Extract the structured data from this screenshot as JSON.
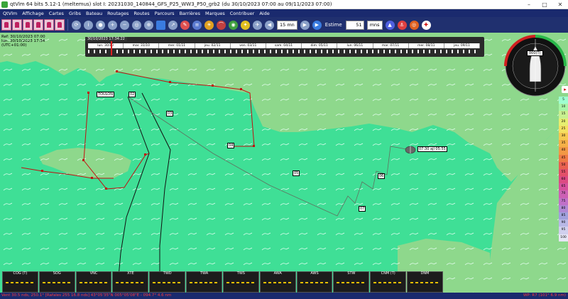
{
  "window": {
    "title": "qtVlm 64 bits 5.12-1 (meltemus) slot I: 20231030_140844_GFS_P25_WW3_P50_grb2 (du 30/10/2023 07:00 au 09/11/2023 07:00)",
    "min": "–",
    "max": "□",
    "close": "✕"
  },
  "menu": [
    "QtVlm",
    "Affichage",
    "Cartes",
    "Gribs",
    "Bateau",
    "Routages",
    "Routes",
    "Parcours",
    "Barrières",
    "Marques",
    "Contribuer",
    "Aide"
  ],
  "toolbar": {
    "step_select": "15 mn",
    "mode_label": "Estime",
    "estime_value": "51",
    "estime_unit": "mns"
  },
  "ref": {
    "line1": "Ref: 30/10/2023 07:00",
    "line2": "lun. 30/10/2023 17:34",
    "line3": "(UTC+01:00)"
  },
  "timeline": {
    "current": "30/10/2023 17:34:22",
    "days": [
      "lun. 30/10",
      "mar. 31/10",
      "mer. 01/11",
      "jeu. 02/11",
      "ven. 03/11",
      "sam. 04/11",
      "dim. 05/11",
      "lun. 06/11",
      "mar. 07/11",
      "mer. 08/11",
      "jeu. 09/11"
    ]
  },
  "map": {
    "toulon_label": "TOULON",
    "boat_label": "07:30 ajl 05:55",
    "marks": [
      "02",
      "03",
      "04",
      "05",
      "06",
      "07"
    ],
    "colors": {
      "sea": "#3fdf96",
      "land": "#8ed88c",
      "route": "#c01010"
    }
  },
  "compass": {
    "heading": "000(T)"
  },
  "grib_scale": [
    "5",
    "10",
    "15",
    "20",
    "25",
    "30",
    "35",
    "40",
    "45",
    "50",
    "55",
    "60",
    "65",
    "70",
    "75",
    "80",
    "85",
    "90",
    "95",
    "100"
  ],
  "instruments": [
    "COG (T)",
    "SOG",
    "VNC",
    "XTE",
    "TWD",
    "TWA",
    "TWS",
    "AWA",
    "AWS",
    "STW",
    "CNM (T)",
    "DNM"
  ],
  "status": {
    "left": "Vent 30.5 nds, 250.1° [Rafales 255 16.8 nds] 43°05'35\"N 005°05'08\"E - 094.7° 4.6 nm",
    "right": "WP: R7 (101° 6.9 nm)"
  }
}
